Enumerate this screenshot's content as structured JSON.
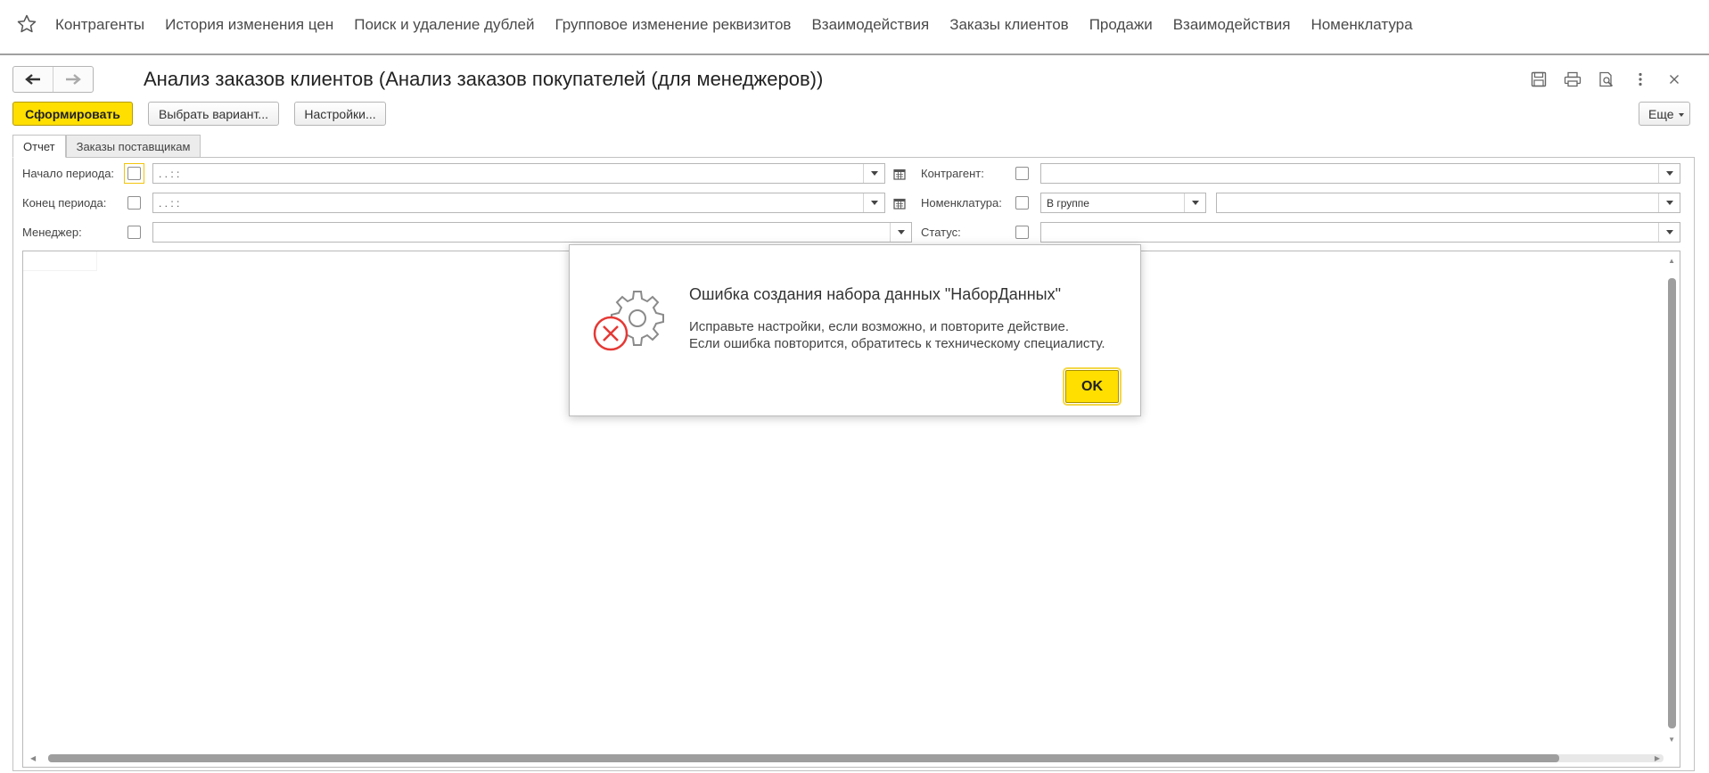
{
  "topnav": {
    "tabs": [
      "Контрагенты",
      "История изменения цен",
      "Поиск и удаление дублей",
      "Групповое изменение реквизитов",
      "Взаимодействия",
      "Заказы клиентов",
      "Продажи",
      "Взаимодействия",
      "Номенклатура"
    ]
  },
  "form": {
    "title": "Анализ заказов клиентов (Анализ заказов покупателей (для менеджеров))",
    "buttons": {
      "generate": "Сформировать",
      "choose_variant": "Выбрать вариант...",
      "settings": "Настройки...",
      "more": "Еще"
    },
    "tabs": [
      "Отчет",
      "Заказы поставщикам"
    ],
    "filters": {
      "period_start_label": "Начало периода:",
      "period_start_value": ". .      : :",
      "period_end_label": "Конец периода:",
      "period_end_value": ". .      : :",
      "manager_label": "Менеджер:",
      "counterparty_label": "Контрагент:",
      "nomenclature_label": "Номенклатура:",
      "nomenclature_mode": "В группе",
      "status_label": "Статус:"
    }
  },
  "dialog": {
    "title": "Ошибка создания набора данных \"НаборДанных\"",
    "line1": "Исправьте настройки, если возможно, и повторите действие.",
    "line2": "Если ошибка повторится, обратитесь к техническому специалисту.",
    "ok": "OK"
  },
  "colors": {
    "accent_yellow": "#fedf00",
    "error_red": "#e53935"
  },
  "icons": [
    "star-icon",
    "back-arrow-icon",
    "forward-arrow-icon",
    "save-icon",
    "print-icon",
    "preview-icon",
    "more-vertical-icon",
    "close-icon",
    "calendar-icon",
    "dropdown-arrow-icon",
    "error-gear-icon"
  ]
}
